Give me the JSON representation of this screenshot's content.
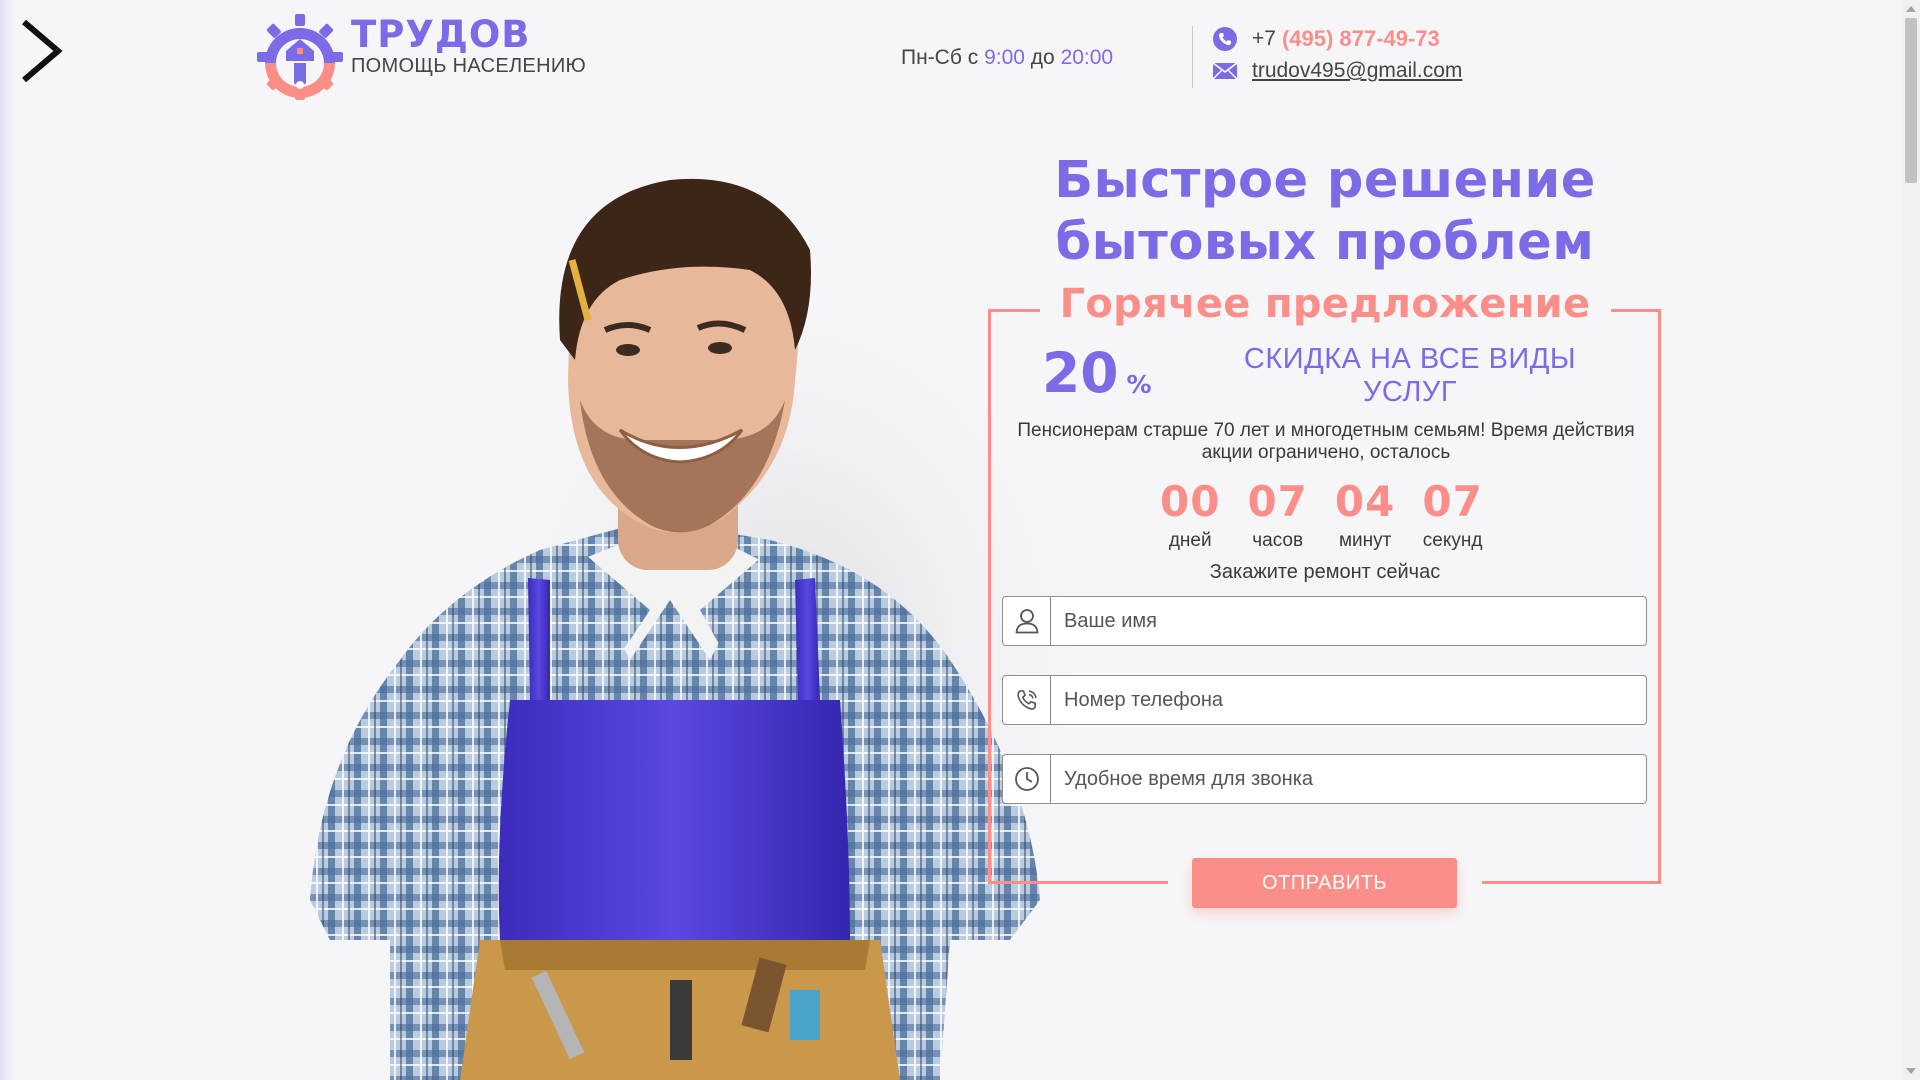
{
  "brand": {
    "title": "ТРУДОВ",
    "subtitle": "ПОМОЩЬ НАСЕЛЕНИЮ",
    "logo_icon": "gear-wrench-house-icon"
  },
  "schedule": {
    "prefix": "Пн-Сб с",
    "from": "9:00",
    "middle": "до",
    "to": "20:00"
  },
  "contacts": {
    "phone_prefix": "+7",
    "phone_number": "(495) 877-49-73",
    "email": "trudov495@gmail.com"
  },
  "hero": {
    "headline_line1": "Быстрое решение",
    "headline_line2": "бытовых проблем"
  },
  "offer": {
    "title": "Горячее предложение",
    "discount_value": "20",
    "discount_unit": "%",
    "discount_text": "СКИДКА НА ВСЕ ВИДЫ УСЛУГ",
    "note": "Пенсионерам старше 70 лет и многодетным семьям! Время действия акции ограничено, осталось"
  },
  "countdown": [
    {
      "value": "00",
      "label": "дней"
    },
    {
      "value": "07",
      "label": "часов"
    },
    {
      "value": "04",
      "label": "минут"
    },
    {
      "value": "07",
      "label": "секунд"
    }
  ],
  "form": {
    "cta": "Закажите ремонт сейчас",
    "name_placeholder": "Ваше имя",
    "phone_placeholder": "Номер телефона",
    "time_placeholder": "Удобное время для звонка",
    "submit_label": "ОТПРАВИТЬ"
  },
  "colors": {
    "accent_purple": "#7b6be6",
    "accent_coral": "#fc8e8a",
    "background": "#f6f6f9"
  }
}
